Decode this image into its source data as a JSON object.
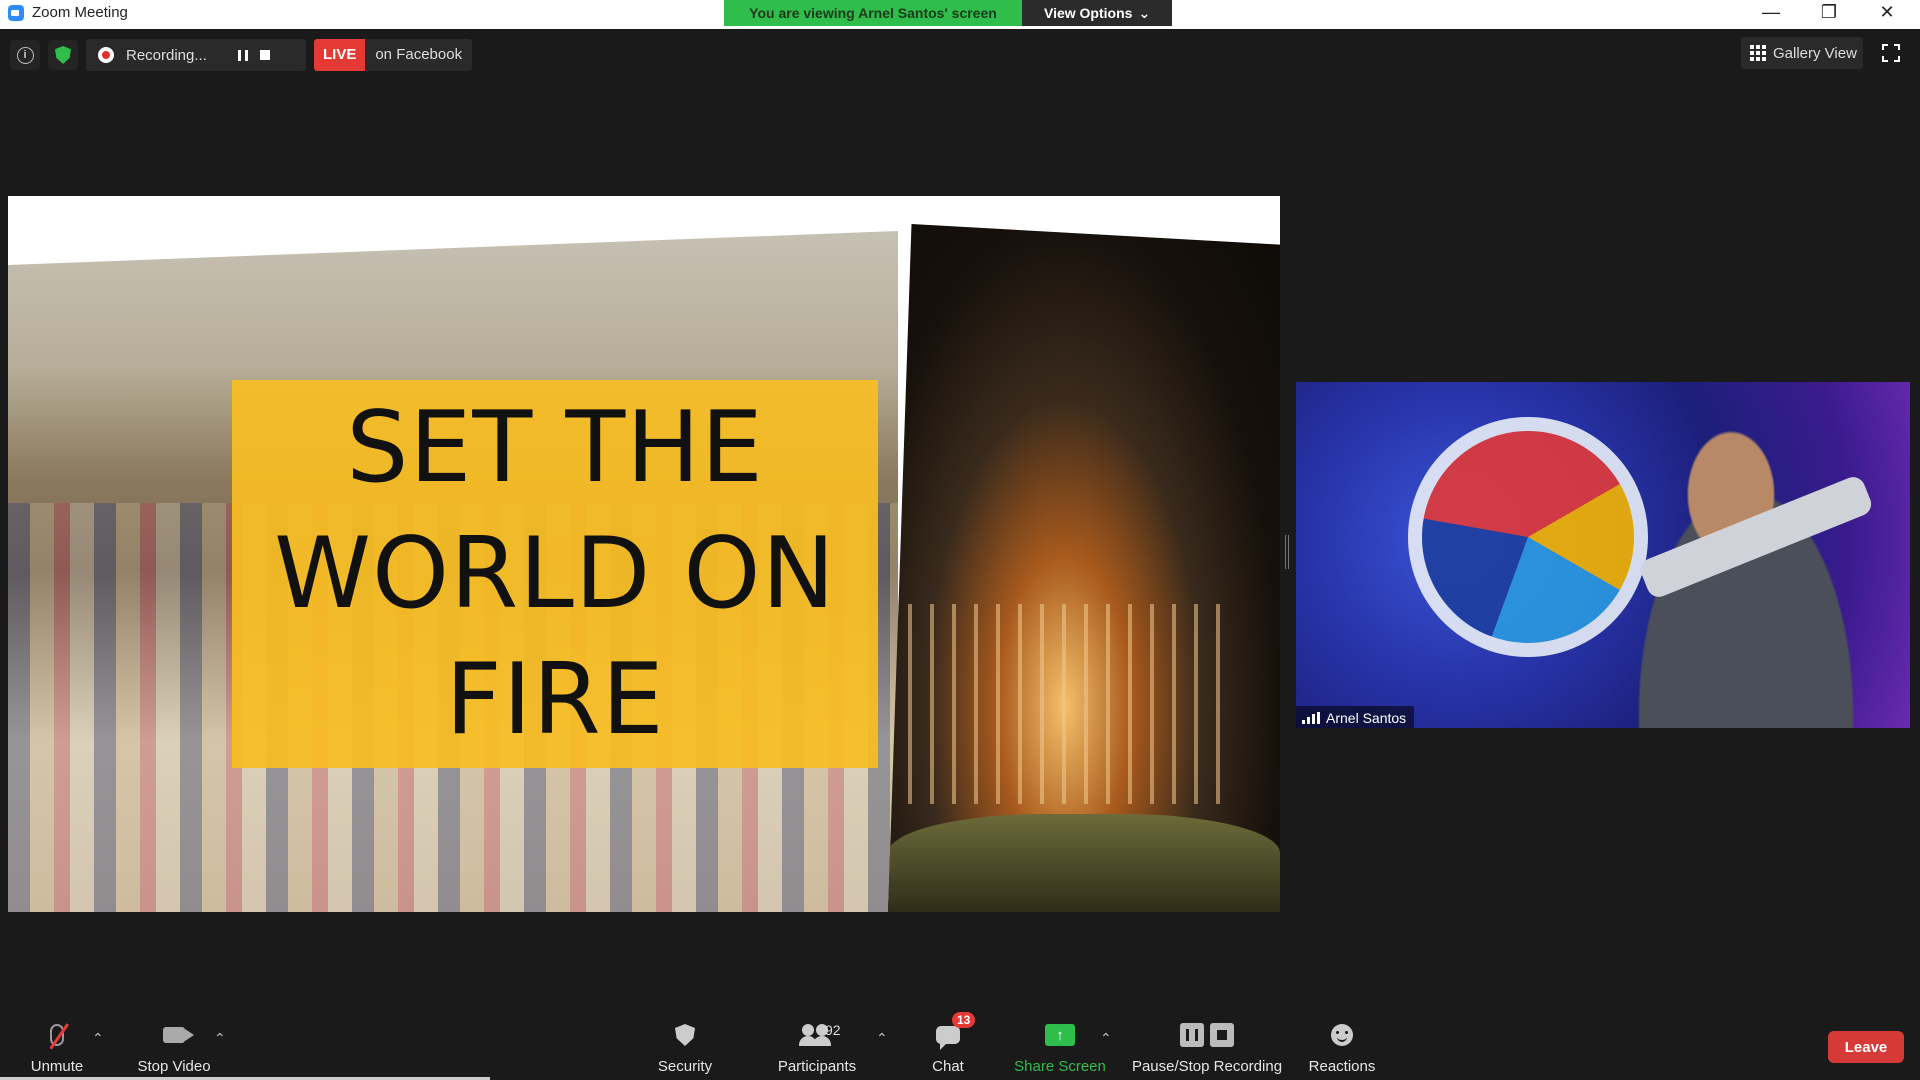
{
  "window": {
    "title": "Zoom Meeting",
    "controls": [
      "—",
      "❐",
      "✕"
    ]
  },
  "banner": {
    "viewing": "You are viewing Arnel Santos' screen",
    "view_options": "View Options"
  },
  "top": {
    "recording": "Recording...",
    "live": "LIVE",
    "live_target": "on Facebook",
    "gallery_view": "Gallery View"
  },
  "shared_screen": {
    "slide_title": [
      "SET THE",
      "WORLD ON",
      "FIRE"
    ],
    "panel_color": "#f7bd22"
  },
  "participant": {
    "name": "Arnel Santos"
  },
  "toolbar": {
    "unmute": "Unmute",
    "stop_video": "Stop Video",
    "security": "Security",
    "participants": "Participants",
    "participants_count": "92",
    "chat": "Chat",
    "chat_badge": "13",
    "share_screen": "Share Screen",
    "pause_stop_recording": "Pause/Stop Recording",
    "reactions": "Reactions",
    "leave": "Leave"
  },
  "colors": {
    "accent_green": "#2fbe4b",
    "live_red": "#e53935",
    "leave_red": "#d63a36"
  }
}
